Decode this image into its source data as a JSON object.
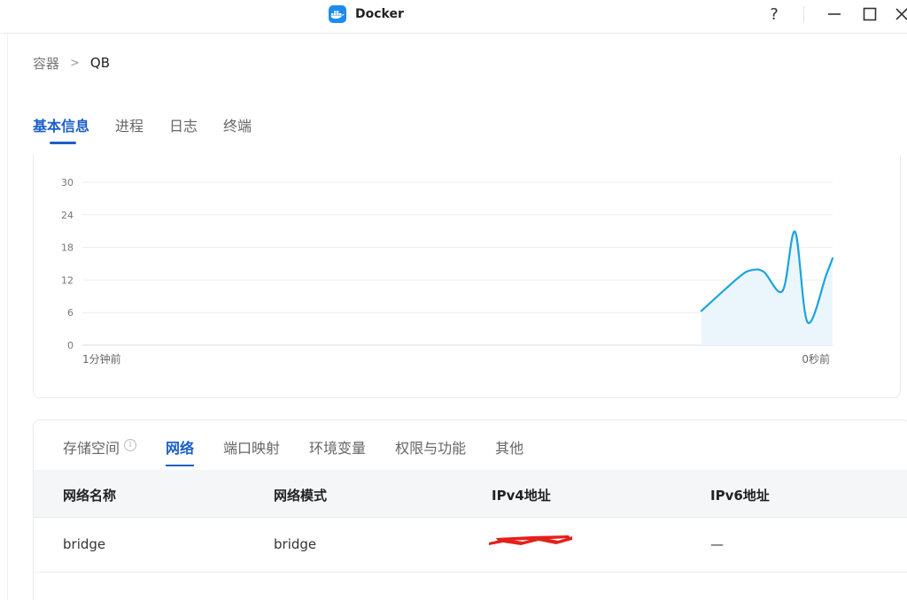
{
  "window": {
    "title": "Docker",
    "help": "?",
    "accent": "#1d8bf0"
  },
  "breadcrumb": {
    "root": "容器",
    "separator": ">",
    "current": "QB"
  },
  "top_tabs": [
    {
      "label": "基本信息",
      "active": true
    },
    {
      "label": "进程",
      "active": false
    },
    {
      "label": "日志",
      "active": false
    },
    {
      "label": "终端",
      "active": false
    }
  ],
  "chart_data": {
    "type": "area",
    "y_ticks": [
      "0",
      "6",
      "12",
      "18",
      "24",
      "30"
    ],
    "ylim": [
      0,
      30
    ],
    "x_labels": {
      "start": "1分钟前",
      "end": "0秒前"
    },
    "xlim": [
      -60,
      0
    ],
    "grid": true,
    "series": [
      {
        "x": [
          -10.5,
          -7.5,
          -6.5,
          -5.5,
          -4.0,
          -3.0,
          -2.0,
          -0.5,
          0
        ],
        "values": [
          6.3,
          12.5,
          13.8,
          13.5,
          10.0,
          20.9,
          4.2,
          13.0,
          16.0
        ],
        "color": "#1aa3e0"
      }
    ]
  },
  "sub_tabs": [
    {
      "label": "存储空间",
      "active": false,
      "info": "i"
    },
    {
      "label": "网络",
      "active": true
    },
    {
      "label": "端口映射",
      "active": false
    },
    {
      "label": "环境变量",
      "active": false
    },
    {
      "label": "权限与功能",
      "active": false
    },
    {
      "label": "其他",
      "active": false
    }
  ],
  "network_table": {
    "headers": [
      "网络名称",
      "网络模式",
      "IPv4地址",
      "IPv6地址"
    ],
    "rows": [
      {
        "name": "bridge",
        "mode": "bridge",
        "ipv4": "",
        "ipv6": "—"
      }
    ]
  }
}
